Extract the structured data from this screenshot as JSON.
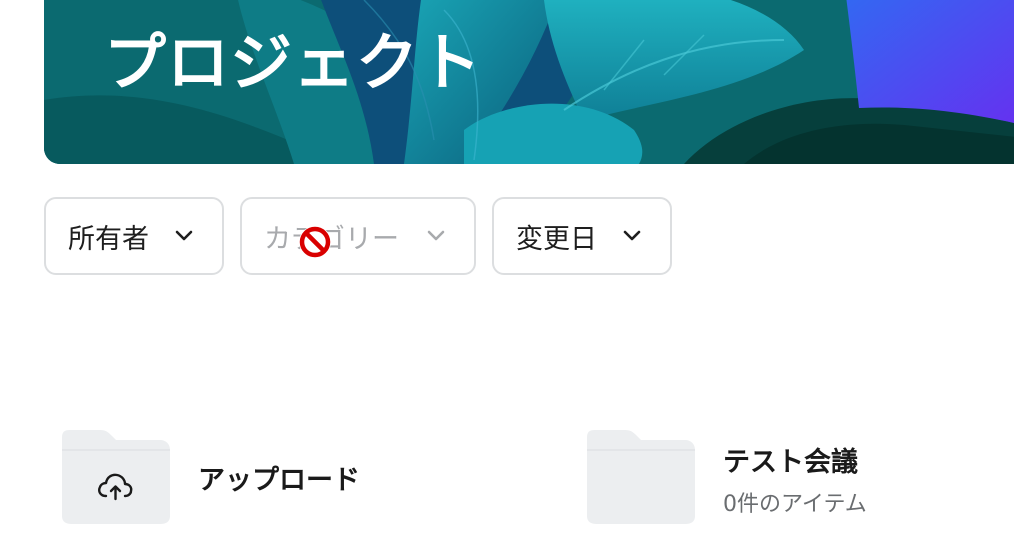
{
  "banner": {
    "title": "プロジェクト"
  },
  "filters": [
    {
      "label": "所有者",
      "disabled": false
    },
    {
      "label": "カテゴリー",
      "disabled": true
    },
    {
      "label": "変更日",
      "disabled": false
    }
  ],
  "cursor": {
    "type": "not-allowed-icon"
  },
  "folders": [
    {
      "name": "アップロード",
      "icon": "cloud-upload-icon",
      "item_count": ""
    },
    {
      "name": "テスト会議",
      "icon": "folder-icon",
      "item_count": "0件のアイテム"
    }
  ],
  "colors": {
    "banner_teal": "#0a6a6e",
    "banner_purple": "#5a3cf0",
    "folder_fill": "#eceef0",
    "filter_border": "#dcdee0",
    "cursor_red": "#d90000"
  }
}
